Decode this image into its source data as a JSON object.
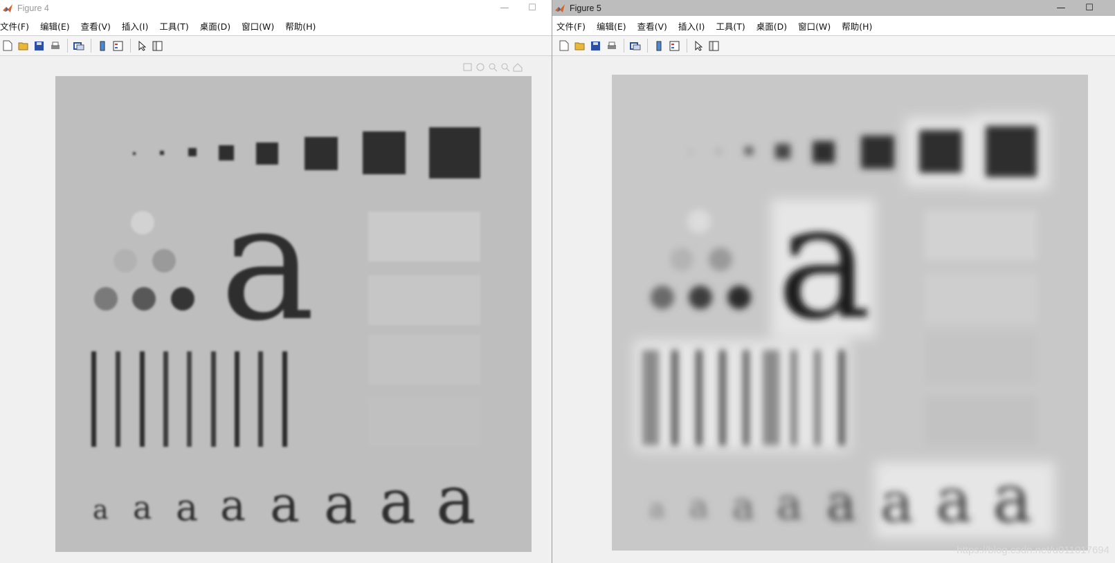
{
  "windows": [
    {
      "title": "Figure 4",
      "menu": [
        "文件(F)",
        "编辑(E)",
        "查看(V)",
        "插入(I)",
        "工具(T)",
        "桌面(D)",
        "窗口(W)",
        "帮助(H)"
      ]
    },
    {
      "title": "Figure 5",
      "menu": [
        "文件(F)",
        "编辑(E)",
        "查看(V)",
        "插入(I)",
        "工具(T)",
        "桌面(D)",
        "窗口(W)",
        "帮助(H)"
      ]
    }
  ],
  "window_controls": {
    "minimize": "—",
    "maximize": "☐"
  },
  "toolbar_icons": [
    "new-file-icon",
    "open-folder-icon",
    "save-icon",
    "print-icon",
    "link-figure-icon",
    "colorbar-icon",
    "legend-icon",
    "edit-plot-arrow-icon",
    "property-inspector-icon"
  ],
  "axes_toolbar_icons": [
    "save-axes-icon",
    "brush-icon",
    "zoom-in-icon",
    "zoom-out-icon",
    "home-icon"
  ],
  "image_text": {
    "large_letter": "a",
    "small_letter": "a"
  },
  "watermark": "https://blog.csdn.net/u011017694",
  "colors": {
    "canvas_fig4": "#bebebe",
    "canvas_fig5": "#c8c8c8",
    "foreground_dark": "#2e2e2e",
    "matlab_icon": "#d8632a"
  }
}
